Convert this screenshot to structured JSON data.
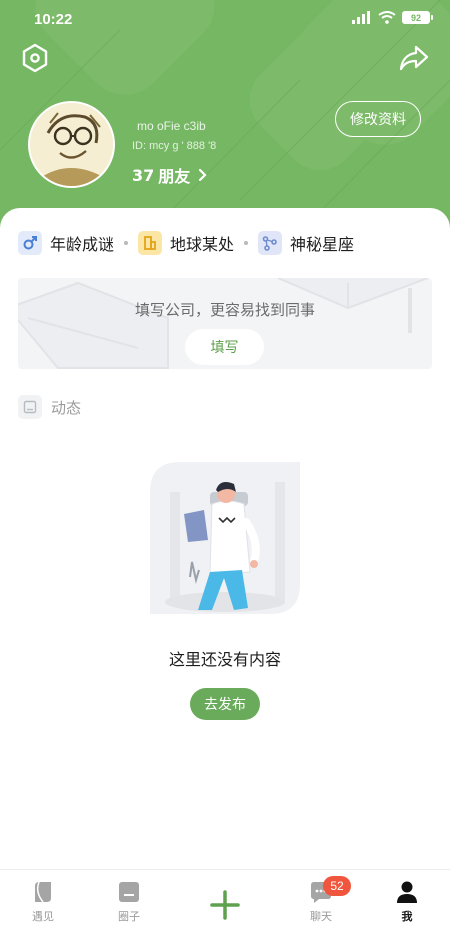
{
  "status_bar": {
    "time": "10:22",
    "battery": "92"
  },
  "profile": {
    "username": "mo  oFie c3ib",
    "user_id": "ID: mcy         g  ' 888  '8",
    "friends_count": "37",
    "friends_label": "朋友",
    "edit_label": "修改资料"
  },
  "tags": [
    {
      "label": "年龄成谜",
      "icon": "male-icon",
      "color": "#4a7fd6"
    },
    {
      "label": "地球某处",
      "icon": "building-icon",
      "color": "#f0b529"
    },
    {
      "label": "神秘星座",
      "icon": "constellation-icon",
      "color": "#6f8ccf"
    }
  ],
  "company_banner": {
    "text": "填写公司，更容易找到同事",
    "button": "填写"
  },
  "moments": {
    "label": "动态"
  },
  "empty_state": {
    "text": "这里还没有内容",
    "button": "去发布"
  },
  "bottom_nav": {
    "items": [
      {
        "label": "遇见",
        "icon": "meet-icon"
      },
      {
        "label": "圈子",
        "icon": "circle-icon"
      },
      {
        "label": "",
        "icon": "plus-icon"
      },
      {
        "label": "聊天",
        "icon": "chat-icon",
        "badge": "52"
      },
      {
        "label": "我",
        "icon": "profile-icon",
        "active": true
      }
    ]
  },
  "colors": {
    "brand_green": "#76b764",
    "button_green": "#6aaa5b",
    "badge_red": "#f0553d"
  }
}
